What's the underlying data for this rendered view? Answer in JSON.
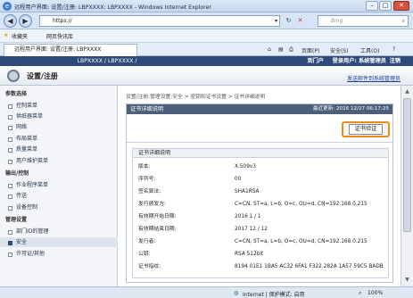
{
  "window": {
    "title": "远程用户界面: 设置/注册: LBPXXXX: LBPXXXX - Windows Internet Explorer"
  },
  "address": {
    "url": "https://",
    "search_placeholder": "Bing"
  },
  "favorites": {
    "label": "收藏夹",
    "gallery": "网页快讯库"
  },
  "tab": {
    "label": "远程用户界面: 设置/注册: LBPXXXX"
  },
  "commands": {
    "page": "页面(P)",
    "safety": "安全(S)",
    "tools": "工具(O)",
    "help": "?"
  },
  "header": {
    "device": "LBPXXXX / LBPXXXX /",
    "portal": "到门户",
    "logged_in": "登录用户: 系统管理员",
    "logout": "注销",
    "title": "设置/注册",
    "mail_link": "发送邮件到系统管理员"
  },
  "sidebar": {
    "pref_group": "参数选择",
    "pref_items": [
      "控制菜单",
      "供纸器菜单",
      "网络",
      "布局菜单",
      "质量菜单",
      "用户维护菜单"
    ],
    "io_group": "输出/控制",
    "io_items": [
      "作业程序菜单",
      "传送",
      "设备控制"
    ],
    "mgmt_group": "管理设置",
    "mgmt_items": [
      "部门ID的管理",
      "安全",
      "许可证/其他"
    ]
  },
  "main": {
    "breadcrumb": "设置/注册:管理设置:安全 > 密钥和证书设置 > 证书详细说明",
    "panel_title": "证书详细说明",
    "updated": "最近更新: 2016 12/27 06:17:25",
    "verify_button": "证书验证",
    "details_title": "证书详细说明",
    "rows": [
      {
        "k": "版本:",
        "v": "X.509v3"
      },
      {
        "k": "序列号:",
        "v": "00"
      },
      {
        "k": "签名算法:",
        "v": "SHA1RSA"
      },
      {
        "k": "发行颁发方:",
        "v": "C=CN, ST=a, L=b, O=c, OU=d, CN=192.168.0.215"
      },
      {
        "k": "有效期开始日期:",
        "v": "2016 1 / 1"
      },
      {
        "k": "有效期结束日期:",
        "v": "2017 12 / 12"
      },
      {
        "k": "发行者:",
        "v": "C=CN, ST=a, L=b, O=c, OU=d, CN=192.168.0.215"
      },
      {
        "k": "公钥:",
        "v": "RSA 512bit"
      },
      {
        "k": "证书指纹:",
        "v": "8194 01E1 1BA5 AC32 6FA1 F322 282A 1A57 59C5 BADB"
      }
    ]
  },
  "status": {
    "zone": "Internet | 保护模式: 启用",
    "zoom": "100%"
  },
  "colors": {
    "accent": "#2d4a7a",
    "highlight": "#f08a1a"
  }
}
